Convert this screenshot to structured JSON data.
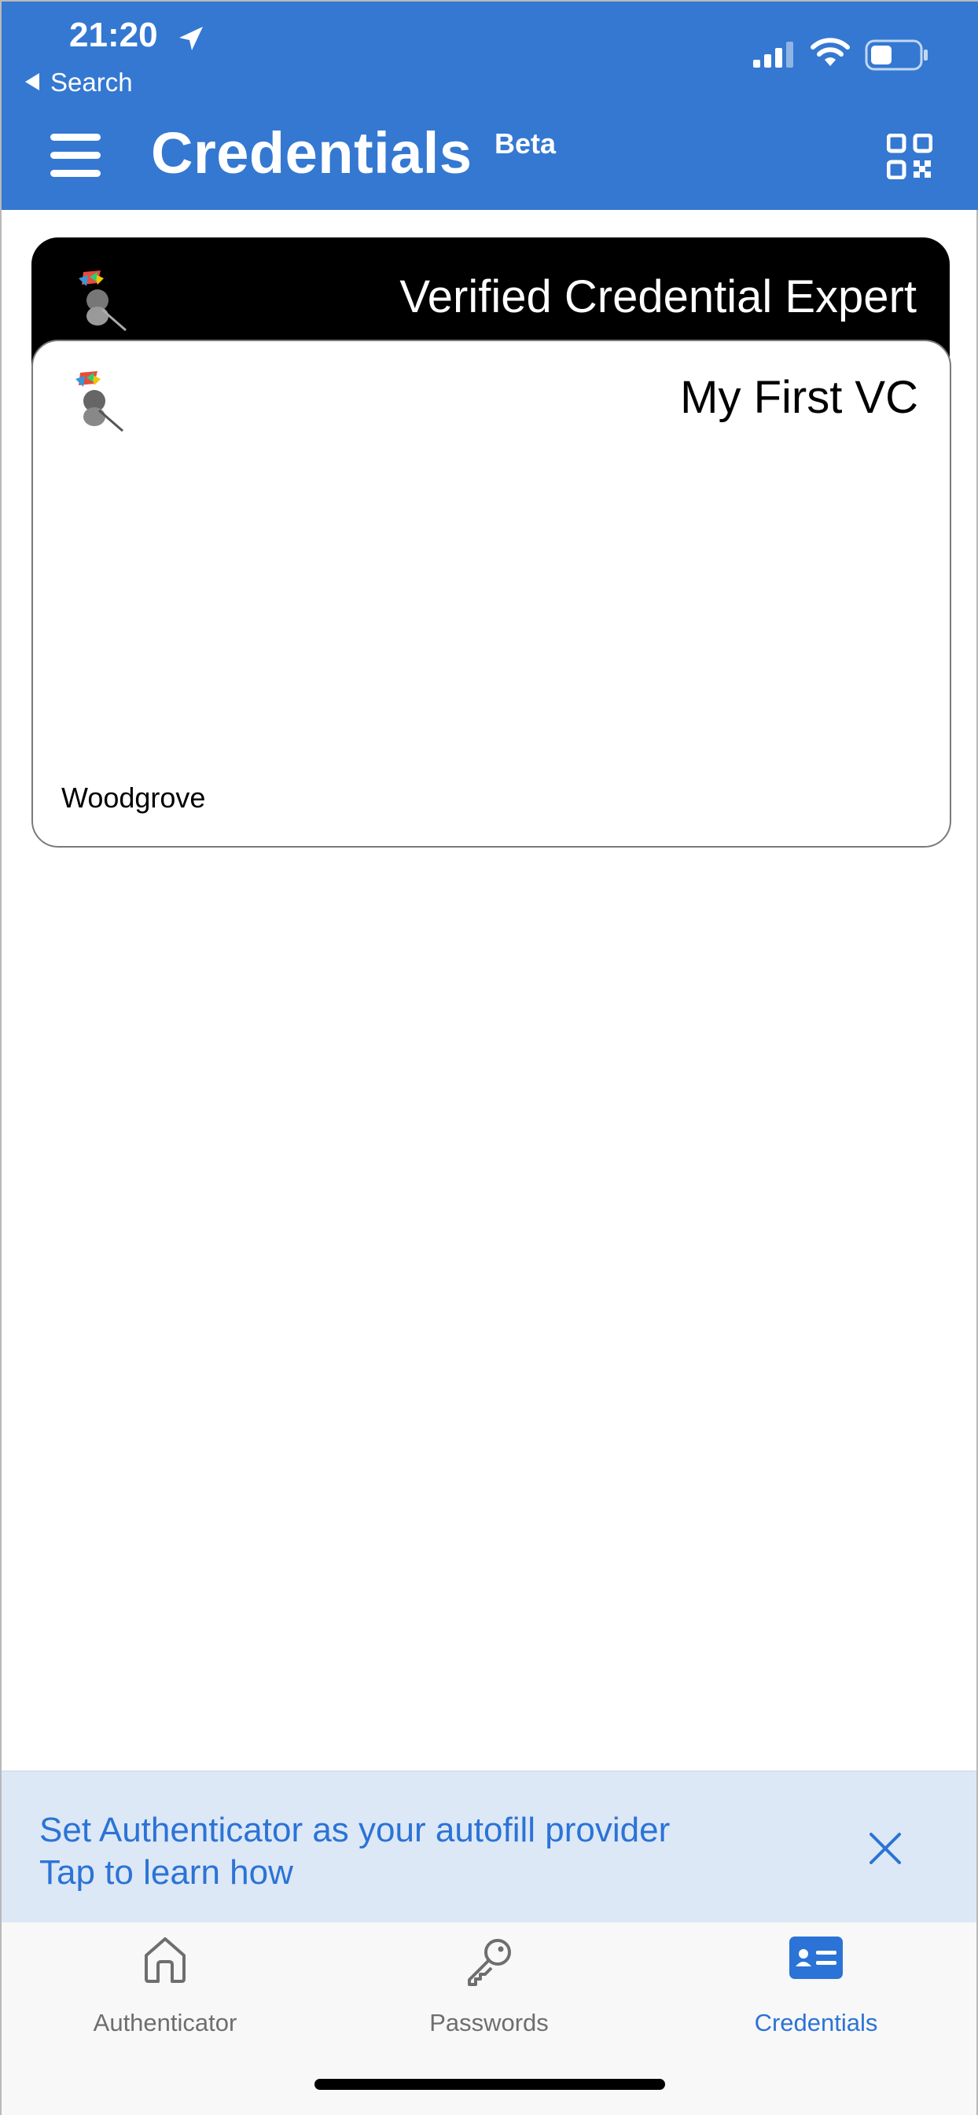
{
  "status_bar": {
    "time": "21:20",
    "back_label": "Search"
  },
  "header": {
    "title": "Credentials",
    "badge": "Beta"
  },
  "cards": [
    {
      "title": "Verified Credential Expert",
      "issuer": ""
    },
    {
      "title": "My First VC",
      "issuer": "Woodgrove"
    }
  ],
  "banner": {
    "line1": "Set Authenticator as your autofill provider",
    "line2": "Tap to learn how"
  },
  "tabs": [
    {
      "label": "Authenticator",
      "icon": "home-icon",
      "active": false
    },
    {
      "label": "Passwords",
      "icon": "key-icon",
      "active": false
    },
    {
      "label": "Credentials",
      "icon": "id-card-icon",
      "active": true
    }
  ],
  "colors": {
    "header": "#3478d2",
    "accent": "#2b73d6",
    "banner_bg": "#dde8f6"
  }
}
